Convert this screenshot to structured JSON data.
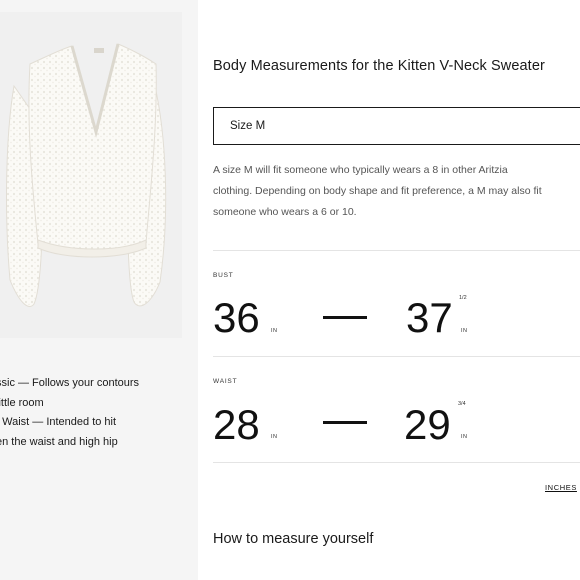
{
  "fit_notes": [
    "ssic — Follows your contours",
    "little room",
    ": Waist — Intended to hit",
    "en the waist and high hip"
  ],
  "panel": {
    "title": "Body Measurements for the Kitten V-Neck Sweater",
    "size_selected": "Size M",
    "description_lines": [
      "A size M will fit someone who typically wears a 8 in other Aritzia",
      "clothing. Depending on body shape and fit preference, a M may also fit",
      "someone who wears a 6 or 10."
    ]
  },
  "measurements": [
    {
      "label": "BUST",
      "min": "36",
      "min_unit": "IN",
      "max": "37",
      "max_frac": "1/2",
      "max_unit": "IN"
    },
    {
      "label": "WAIST",
      "min": "28",
      "min_unit": "IN",
      "max": "29",
      "max_frac": "3/4",
      "max_unit": "IN"
    }
  ],
  "units_link": "INCHES",
  "how_to_heading": "How to measure yourself",
  "colors": {
    "text": "#1a1a1a",
    "border": "#1a1a1a",
    "divider": "#e4e4e4",
    "left_bg": "#f5f5f5"
  }
}
